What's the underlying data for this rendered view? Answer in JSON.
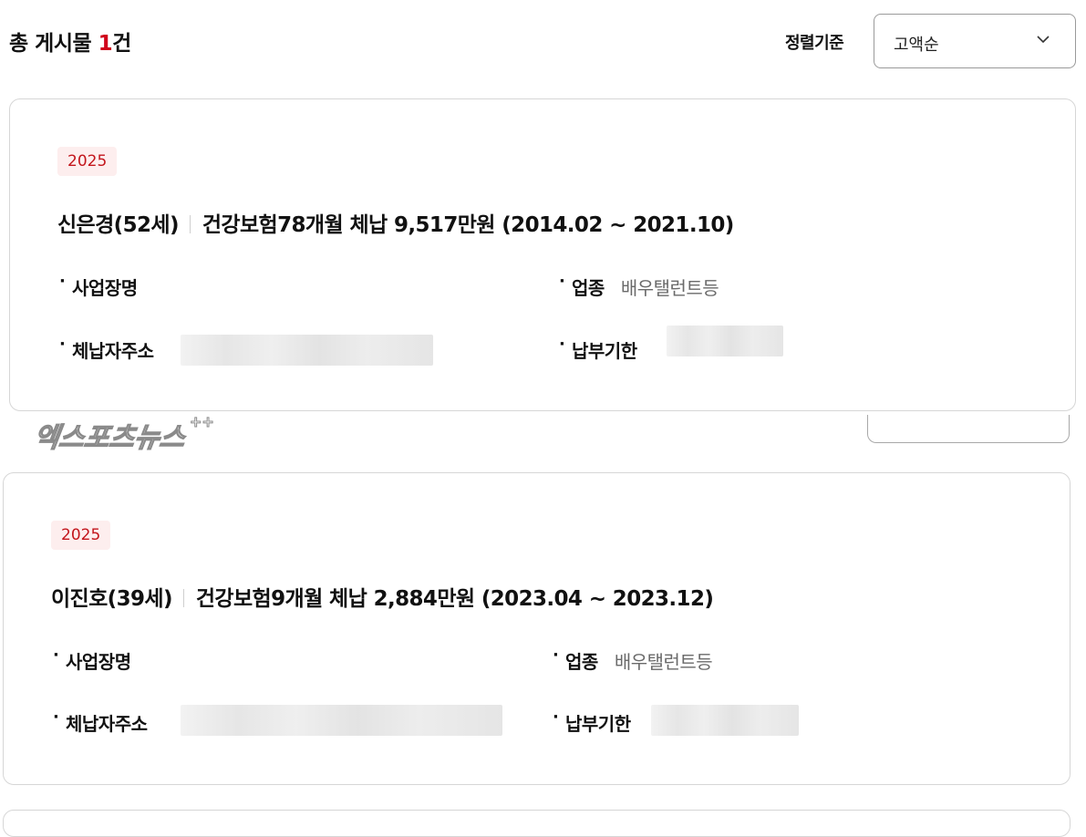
{
  "header": {
    "total_prefix": "총 게시물 ",
    "total_count": "1",
    "total_suffix": "건",
    "sort_label": "정렬기준",
    "sort_value": "고액순"
  },
  "cards": [
    {
      "year": "2025",
      "name": "신은경(52세)",
      "summary": "건강보험78개월 체납 9,517만원 (2014.02 ~ 2021.10)",
      "business_label": "사업장명",
      "industry_label": "업종",
      "industry_value": "배우탤런트등",
      "address_label": "체납자주소",
      "deadline_label": "납부기한"
    },
    {
      "year": "2025",
      "name": "이진호(39세)",
      "summary": "건강보험9개월 체납 2,884만원 (2023.04 ~ 2023.12)",
      "business_label": "사업장명",
      "industry_label": "업종",
      "industry_value": "배우탤런트등",
      "address_label": "체납자주소",
      "deadline_label": "납부기한"
    }
  ],
  "watermark": {
    "text": "엑스포츠뉴스"
  },
  "icons": {
    "sort_dropdown": "chevron-down-icon",
    "bullet": "bullet-dot"
  },
  "colors": {
    "accent_red": "#d0021b",
    "badge_bg": "#fdeeee",
    "badge_text": "#c3161c",
    "value_gray": "#6a6a6a",
    "card_border": "#d6d6d6"
  }
}
